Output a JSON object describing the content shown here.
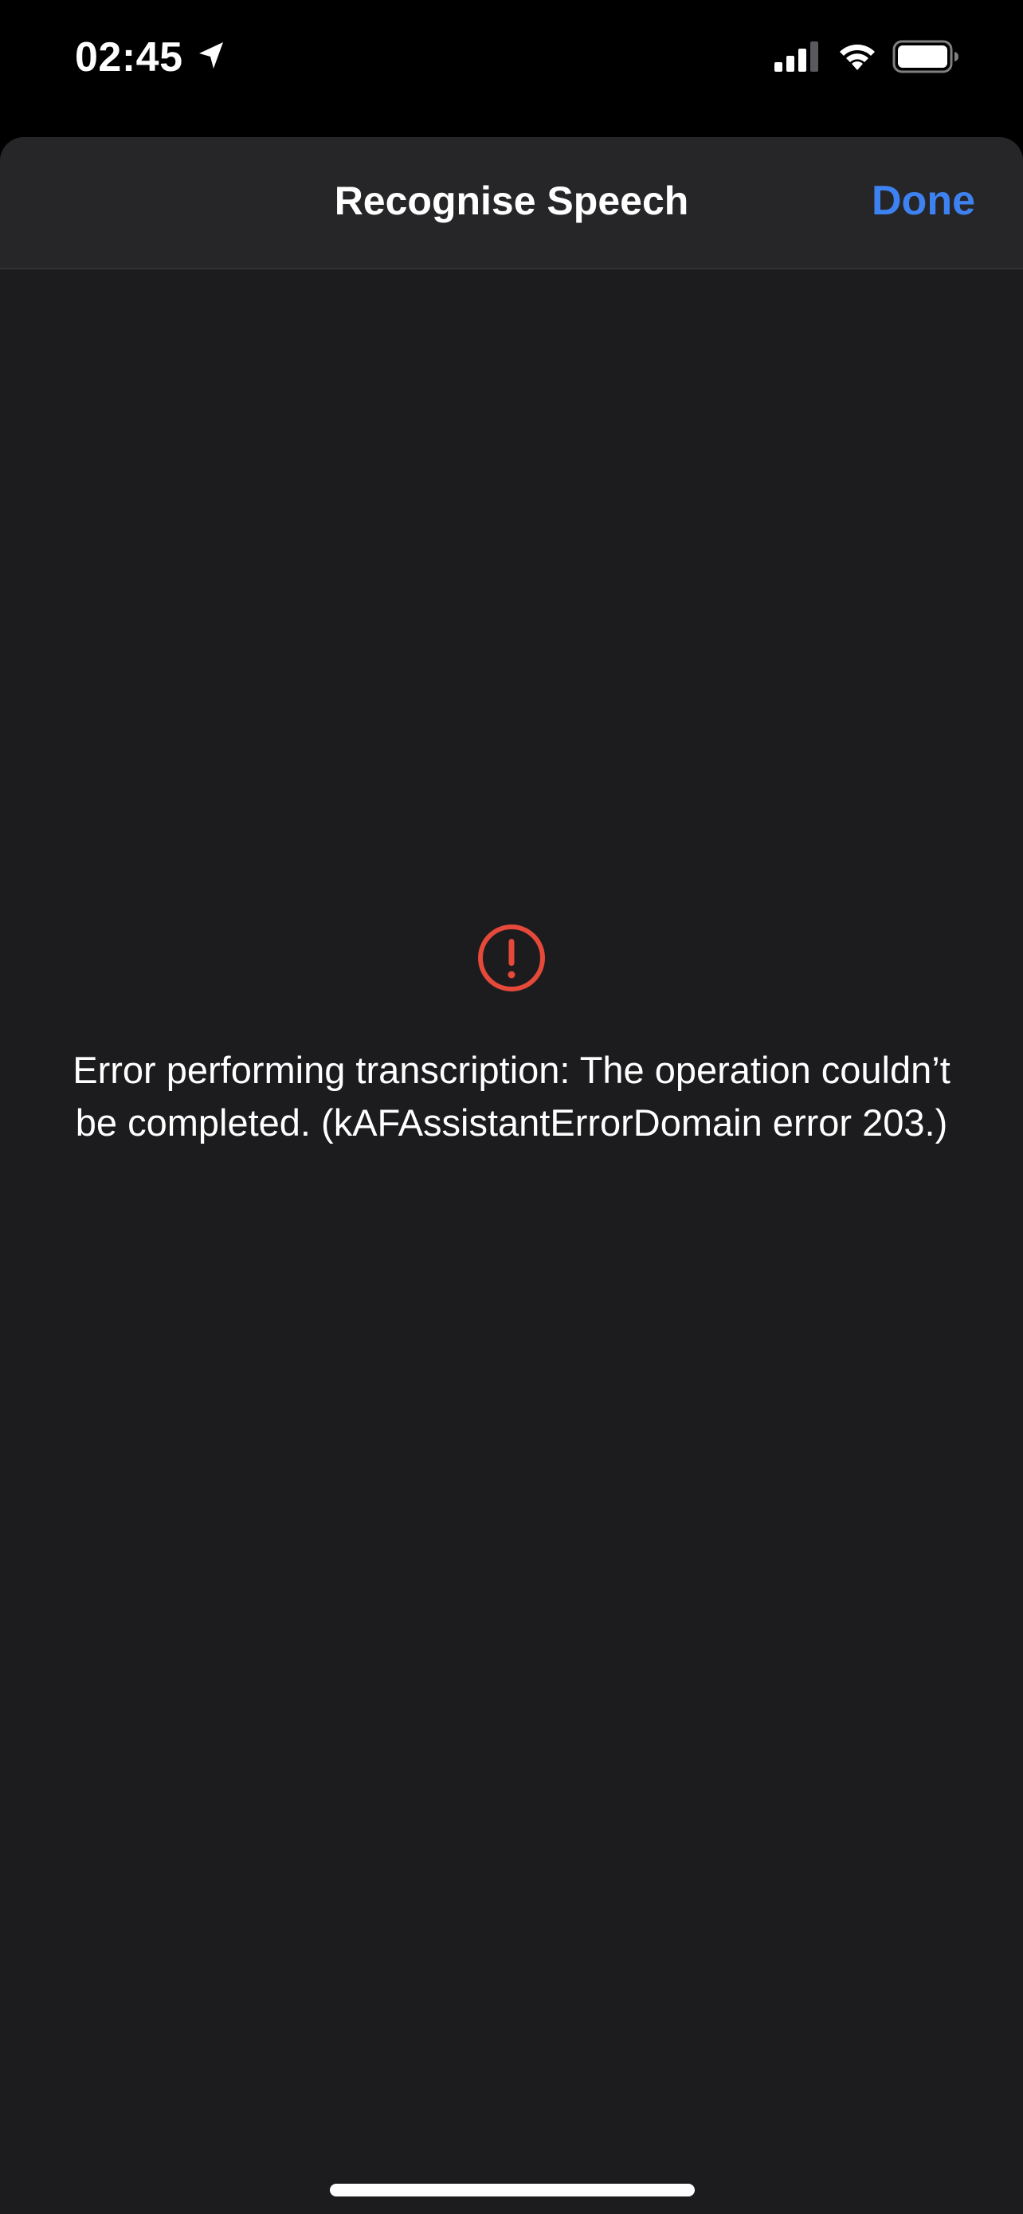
{
  "status_bar": {
    "time": "02:45",
    "icons": [
      "location-arrow-icon",
      "cellular-signal-icon",
      "wifi-icon",
      "battery-icon"
    ]
  },
  "sheet": {
    "title": "Recognise Speech",
    "done_label": "Done"
  },
  "error": {
    "icon": "exclamation-circle-icon",
    "message": "Error performing transcription: The operation couldn’t be completed. (kAFAssistantErrorDomain error 203.)"
  },
  "colors": {
    "accent": "#3d82f0",
    "error": "#e5493a",
    "background": "#1c1c1e",
    "nav_background": "#262628"
  }
}
